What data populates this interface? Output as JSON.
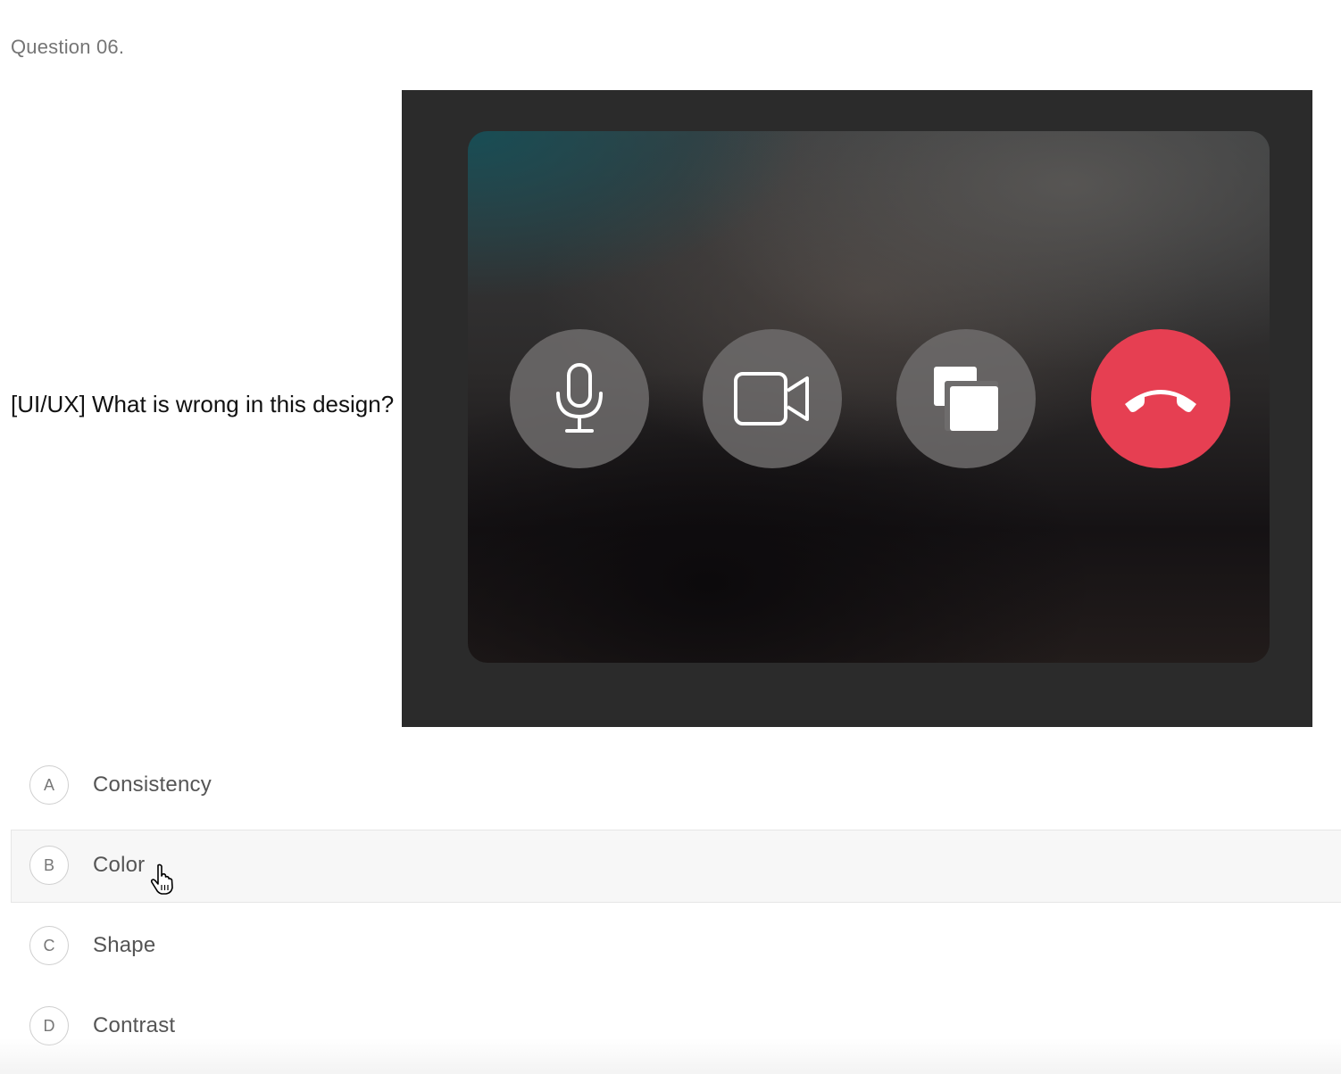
{
  "question": {
    "number": "Question 06.",
    "text": "[UI/UX] What is wrong in this design?"
  },
  "image": {
    "call_controls": [
      {
        "name": "microphone",
        "icon": "microphone-icon",
        "color": "#6e6c6c"
      },
      {
        "name": "camera",
        "icon": "video-camera-icon",
        "color": "#6e6c6c"
      },
      {
        "name": "screen share",
        "icon": "screen-share-icon",
        "color": "#6e6c6c"
      },
      {
        "name": "end call",
        "icon": "end-call-icon",
        "color": "#e63f52"
      }
    ]
  },
  "options": [
    {
      "letter": "A",
      "label": "Consistency"
    },
    {
      "letter": "B",
      "label": "Color"
    },
    {
      "letter": "C",
      "label": "Shape"
    },
    {
      "letter": "D",
      "label": "Contrast"
    }
  ],
  "colors": {
    "end_call": "#e63f52",
    "hover_background": "#f7f7f7",
    "option_border": "#cfcfcf"
  }
}
